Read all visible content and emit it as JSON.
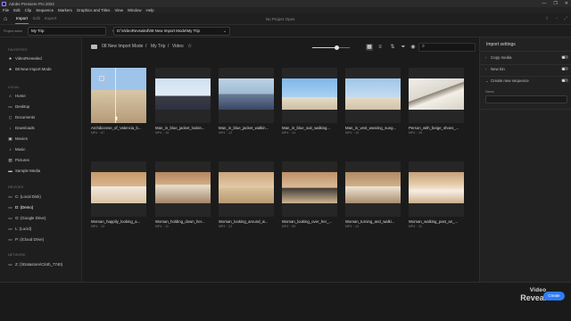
{
  "window": {
    "title": "Adobe Premiere Pro 2022",
    "controls": [
      "—",
      "❐",
      "✕"
    ]
  },
  "menu": [
    "File",
    "Edit",
    "Clip",
    "Sequence",
    "Markers",
    "Graphics and Titles",
    "View",
    "Window",
    "Help"
  ],
  "workspace": {
    "tabs": [
      "Import",
      "Edit",
      "Export"
    ],
    "active_tab": "Import",
    "project_status": "No Project Open"
  },
  "project_bar": {
    "name_label": "Project name",
    "name_value": "My Trip",
    "location_label": "Project location",
    "location_value": "D:\\VideoRevealed\\08 New Import Mode\\My Trip"
  },
  "sidebar": {
    "favorites_heading": "FAVORITES",
    "favorites": [
      {
        "label": "VideoRevealed",
        "icon": "star-icon"
      },
      {
        "label": "08 New Import Mode",
        "icon": "star-icon"
      }
    ],
    "local_heading": "LOCAL",
    "local": [
      {
        "label": "Home",
        "icon": "home-icon"
      },
      {
        "label": "Desktop",
        "icon": "desktop-icon"
      },
      {
        "label": "Documents",
        "icon": "document-icon"
      },
      {
        "label": "Downloads",
        "icon": "download-icon"
      },
      {
        "label": "Movies",
        "icon": "movie-icon"
      },
      {
        "label": "Music",
        "icon": "music-icon"
      },
      {
        "label": "Pictures",
        "icon": "picture-icon"
      },
      {
        "label": "Sample Media",
        "icon": "folder-icon"
      }
    ],
    "devices_heading": "DEVICES",
    "devices": [
      {
        "label": "C: (Local Disk)",
        "icon": "drive-icon"
      },
      {
        "label": "D: (Demo)",
        "icon": "drive-icon",
        "selected": true
      },
      {
        "label": "G: (Google Drive)",
        "icon": "drive-icon"
      },
      {
        "label": "L: (Lucid)",
        "icon": "drive-icon"
      },
      {
        "label": "P: (iCloud Drive)",
        "icon": "drive-icon"
      }
    ],
    "network_heading": "NETWORK",
    "network": [
      {
        "label": "Z: (\\\\Datastore\\Cloth_7740)",
        "icon": "network-drive-icon"
      }
    ]
  },
  "browser": {
    "breadcrumbs": [
      "08 New Import Mode",
      "My Trip",
      "Video"
    ],
    "search_placeholder": "",
    "zoom_level": 0.6,
    "clips": [
      {
        "name": "Archdiocese_of_Valencia_b...",
        "meta": "MP4 · :57",
        "selected": true
      },
      {
        "name": "Man_in_blue_jacket_lookin...",
        "meta": "MP4 · :15"
      },
      {
        "name": "Man_in_blue_jacket_walkin...",
        "meta": "MP4 · :12"
      },
      {
        "name": "Man_in_blue_suit_walking...",
        "meta": "MP4 · :14"
      },
      {
        "name": "Man_in_vest_wearing_sung...",
        "meta": "MP4 · :10"
      },
      {
        "name": "Person_with_beige_shoes_...",
        "meta": "MP4 · :15"
      },
      {
        "name": "Woman_happily_looking_a...",
        "meta": "MP4 · :13"
      },
      {
        "name": "Woman_holding_down_her...",
        "meta": "MP4 · :11"
      },
      {
        "name": "Woman_looking_around_w...",
        "meta": "MP4 · :12"
      },
      {
        "name": "Woman_looking_over_her_...",
        "meta": "MP4 · :09"
      },
      {
        "name": "Woman_turning_and_walki...",
        "meta": "MP4 · :14"
      },
      {
        "name": "Woman_walking_past_an_...",
        "meta": "MP4 · :11"
      }
    ]
  },
  "import_settings": {
    "title": "Import settings",
    "options": [
      {
        "label": "Copy media",
        "on": false
      },
      {
        "label": "New bin",
        "on": false
      },
      {
        "label": "Create new sequence",
        "on": false
      }
    ],
    "name_label": "Name"
  },
  "bottom": {
    "create_label": "Create"
  },
  "watermark": {
    "line1": "Video",
    "line2": "Revealed"
  },
  "colors": {
    "accent": "#2f7cf6",
    "selection": "#3e6fbd"
  }
}
